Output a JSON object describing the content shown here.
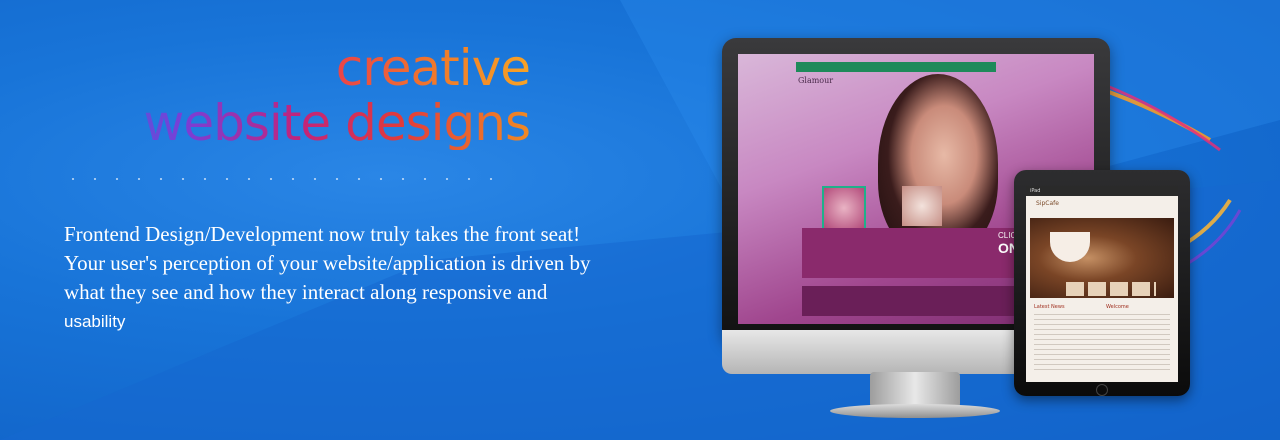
{
  "banner": {
    "headline_line1": "creative",
    "headline_line2": "website designs",
    "tagline_lines": [
      "Frontend Design/Development now truly takes the front seat!",
      "Your user's perception of your website/application is driven by",
      "what they see and how they interact along responsive and",
      "usability"
    ]
  },
  "monitor_site": {
    "logo": "Glamour",
    "click_here": "CLICK HERE",
    "online": "ONLINE"
  },
  "tablet_site": {
    "status_left": "iPad",
    "brand": "SipCafe",
    "section_left": "Latest News",
    "section_right": "Welcome"
  },
  "colors": {
    "background": "#1874d8",
    "headline_pink": "#e8245a",
    "headline_orange": "#f7a326",
    "headline_blue": "#3b68e0"
  }
}
